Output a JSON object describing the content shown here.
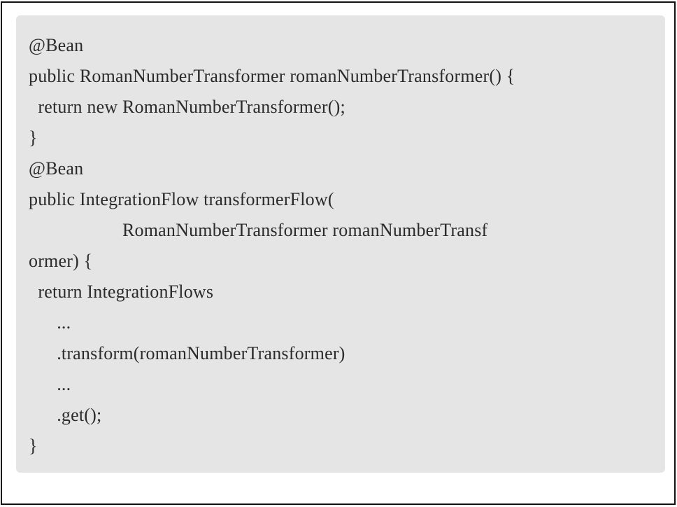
{
  "document": {
    "code_lines": [
      "@Bean",
      "public RomanNumberTransformer romanNumberTransformer() {",
      "  return new RomanNumberTransformer();",
      "}",
      "@Bean",
      "public IntegrationFlow transformerFlow(",
      "                    RomanNumberTransformer romanNumberTransf",
      "ormer) {",
      "  return IntegrationFlows",
      "      ...",
      "      .transform(romanNumberTransformer)",
      "      ...",
      "      .get();",
      "}"
    ],
    "colors": {
      "code_background": "#e5e5e5",
      "code_text": "#2b2b2b",
      "frame_border": "#111111"
    }
  }
}
